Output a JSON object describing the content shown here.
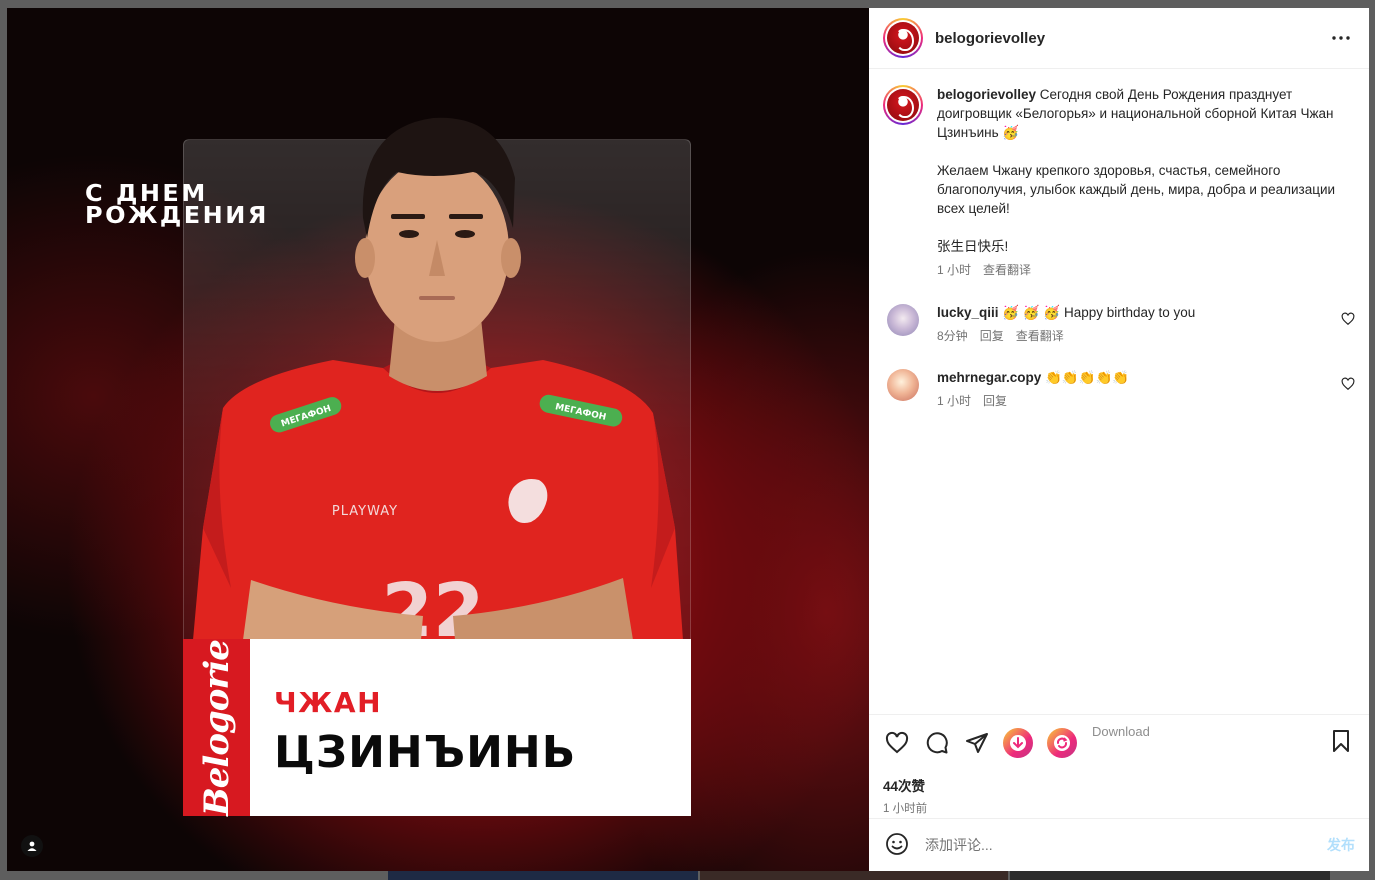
{
  "media": {
    "headline_line1": "С ДНЕМ",
    "headline_line2": "РОЖДЕНИЯ",
    "brand": "Belogorie",
    "first_name": "ЧЖАН",
    "last_name": "ЦЗИНЪИНЬ",
    "jersey_sponsor": "МЕГАФОН",
    "jersey_brand": "PLAYWAY",
    "jersey_number": "22"
  },
  "header": {
    "username": "belogorievolley"
  },
  "caption": {
    "username": "belogorievolley",
    "line1": " Сегодня свой День Рождения празднует доигровщик «Белогорья» и национальной сборной Китая Чжан Цзинъинь 🥳",
    "line2": "Желаем Чжану крепкого здоровья, счастья, семейного благополучия, улыбок каждый день, мира, добра и реализации всех целей!",
    "line3": "张生日快乐!",
    "time": "1 小时",
    "translate": "查看翻译"
  },
  "comments": [
    {
      "username": "lucky_qiii",
      "text": " 🥳 🥳 🥳 Happy birthday to you",
      "time": "8分钟",
      "reply": "回复",
      "translate": "查看翻译"
    },
    {
      "username": "mehrnegar.copy",
      "text": " 👏👏👏👏👏",
      "time": "1 小时",
      "reply": "回复"
    }
  ],
  "actions": {
    "download_label": "Download",
    "likes": "44次赞",
    "post_time": "1 小时前"
  },
  "add_comment": {
    "placeholder": "添加评论...",
    "post_label": "发布"
  },
  "colors": {
    "accent_red": "#d71920",
    "post_button_disabled": "#b2dffc"
  }
}
